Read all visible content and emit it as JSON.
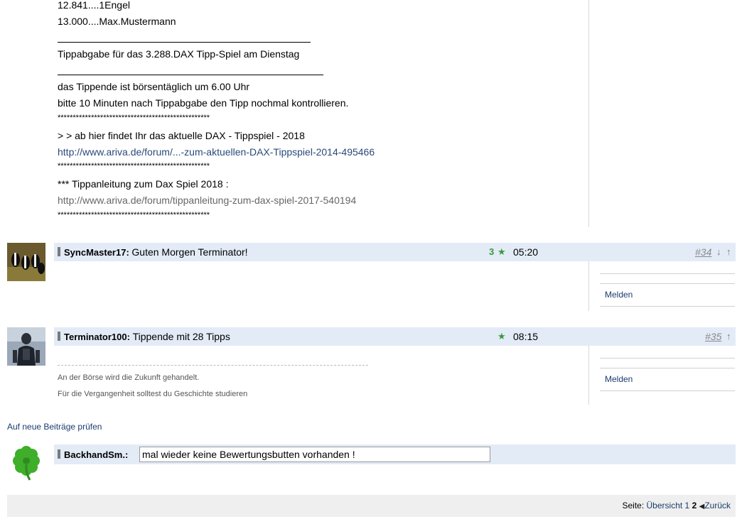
{
  "post_body": {
    "lines": {
      "engel": "12.841....1Engel",
      "max": "13.000....Max.Mustermann",
      "tippabgabe": "Tippabgabe für das  3.288.DAX Tipp-Spiel am Dienstag",
      "tippende": "das Tippende ist börsentäglich um 6.00 Uhr",
      "bitte": "bitte 10 Minuten nach Tippabgabe den Tipp nochmal kontrollieren.",
      "stars": "**************************************************",
      "ab_hier": "> >  ab hier findet Ihr das aktuelle  DAX - Tippspiel - 2018",
      "link1": "http://www.ariva.de/forum/...-zum-aktuellen-DAX-Tippspiel-2014-495466",
      "anleitung": "***  Tippanleitung zum Dax Spiel 2018 :",
      "link2": "http://www.ariva.de/forum/tippanleitung-zum-dax-spiel-2017-540194"
    }
  },
  "posts": [
    {
      "author": "SyncMaster17:",
      "title": "Guten Morgen Terminator!",
      "stars_count": "3",
      "star_icon": "star-icon",
      "time": "05:20",
      "number": "#34",
      "arrow_down": "↓",
      "arrow_up": "↑",
      "report_label": "Melden"
    },
    {
      "author": "Terminator100:",
      "title": "Tippende mit 28 Tipps",
      "star_icon": "star-icon",
      "time": "08:15",
      "number": "#35",
      "arrow_up": "↑",
      "signature_1": "An der Börse wird die Zukunft gehandelt.",
      "signature_2": "Für die Vergangenheit solltest du Geschichte studieren",
      "report_label": "Melden"
    }
  ],
  "check_new_label": "Auf neue Beiträge prüfen",
  "reply": {
    "author": "BackhandSm.:",
    "input_value": "mal wieder keine Bewertungsbutten vorhanden !"
  },
  "pagination": {
    "label": "Seite:",
    "overview": "Übersicht",
    "page1": "1",
    "page2": "2",
    "back": "Zurück"
  },
  "colors": {
    "post_bar": "#e3ebf7",
    "link": "#1a3c6e",
    "star": "#3a9a3a"
  }
}
